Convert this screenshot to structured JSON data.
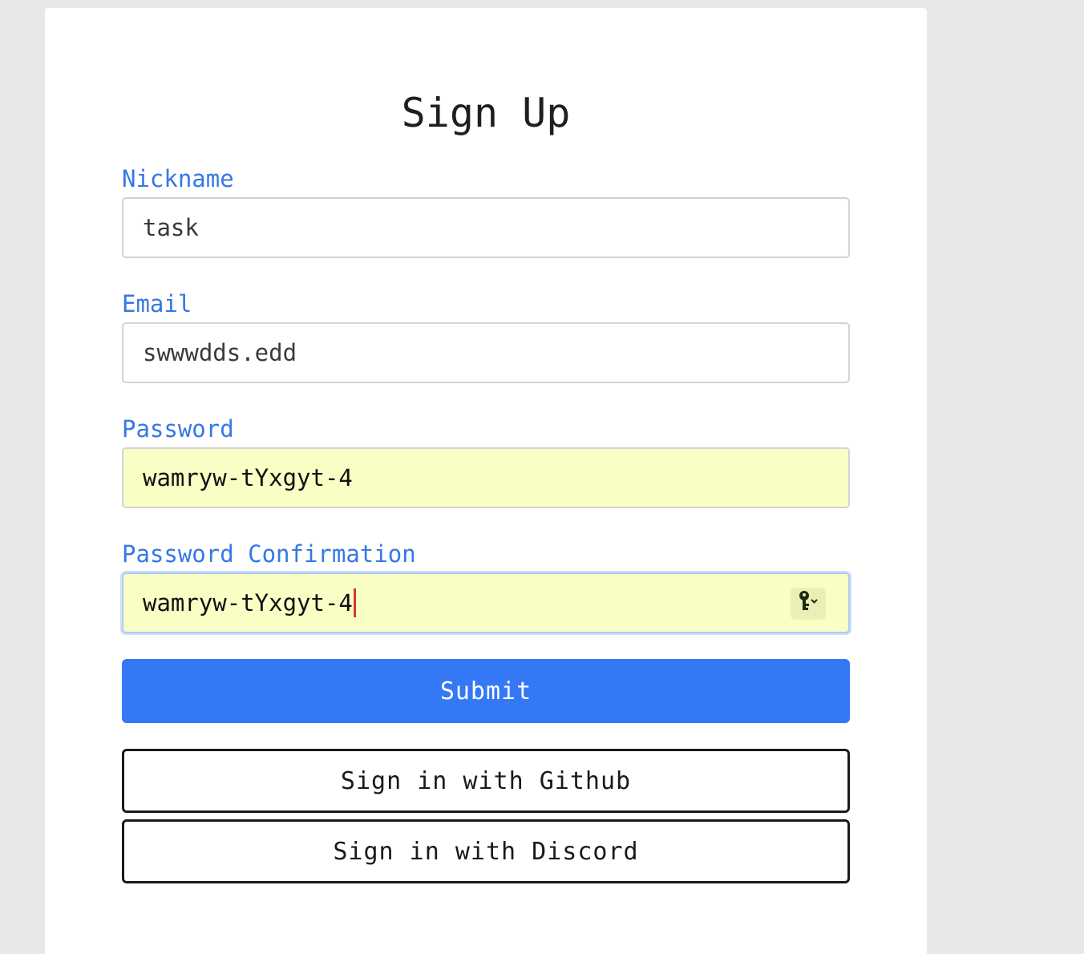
{
  "form": {
    "title": "Sign Up",
    "nickname": {
      "label": "Nickname",
      "value": "task"
    },
    "email": {
      "label": "Email",
      "value": "swwwdds.edd"
    },
    "password": {
      "label": "Password",
      "value": "wamryw-tYxgyt-4"
    },
    "password_confirmation": {
      "label": "Password Confirmation",
      "value": "wamryw-tYxgyt-4"
    },
    "submit_label": "Submit",
    "github_label": "Sign in with Github",
    "discord_label": "Sign in with Discord"
  },
  "icons": {
    "password_manager": "key-icon"
  },
  "colors": {
    "page_background": "#e8e8e8",
    "label": "#3578e5",
    "submit_background": "#3578f5",
    "autofill_background": "#f9fec4",
    "caret": "#d23b2c"
  }
}
